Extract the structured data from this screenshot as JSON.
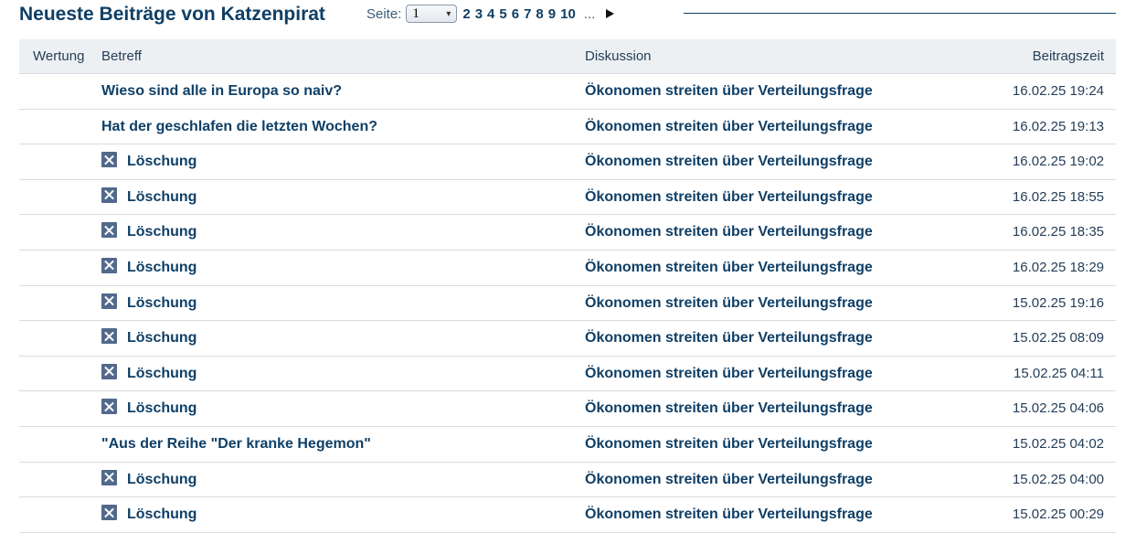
{
  "header": {
    "title": "Neueste Beiträge von Katzenpirat",
    "pager_label": "Seite:",
    "page_select_value": "1",
    "pages": [
      "2",
      "3",
      "4",
      "5",
      "6",
      "7",
      "8",
      "9",
      "10"
    ],
    "ellipsis": "..."
  },
  "table": {
    "columns": {
      "rating": "Wertung",
      "subject": "Betreff",
      "discussion": "Diskussion",
      "time": "Beitragszeit"
    },
    "rows": [
      {
        "deleted": false,
        "subject": "Wieso sind alle in Europa so naiv?",
        "discussion": "Ökonomen streiten über Verteilungsfrage",
        "time": "16.02.25 19:24"
      },
      {
        "deleted": false,
        "subject": "Hat der geschlafen die letzten Wochen?",
        "discussion": "Ökonomen streiten über Verteilungsfrage",
        "time": "16.02.25 19:13"
      },
      {
        "deleted": true,
        "subject": "Löschung",
        "discussion": "Ökonomen streiten über Verteilungsfrage",
        "time": "16.02.25 19:02"
      },
      {
        "deleted": true,
        "subject": "Löschung",
        "discussion": "Ökonomen streiten über Verteilungsfrage",
        "time": "16.02.25 18:55"
      },
      {
        "deleted": true,
        "subject": "Löschung",
        "discussion": "Ökonomen streiten über Verteilungsfrage",
        "time": "16.02.25 18:35"
      },
      {
        "deleted": true,
        "subject": "Löschung",
        "discussion": "Ökonomen streiten über Verteilungsfrage",
        "time": "16.02.25 18:29"
      },
      {
        "deleted": true,
        "subject": "Löschung",
        "discussion": "Ökonomen streiten über Verteilungsfrage",
        "time": "15.02.25 19:16"
      },
      {
        "deleted": true,
        "subject": "Löschung",
        "discussion": "Ökonomen streiten über Verteilungsfrage",
        "time": "15.02.25 08:09"
      },
      {
        "deleted": true,
        "subject": "Löschung",
        "discussion": "Ökonomen streiten über Verteilungsfrage",
        "time": "15.02.25 04:11"
      },
      {
        "deleted": true,
        "subject": "Löschung",
        "discussion": "Ökonomen streiten über Verteilungsfrage",
        "time": "15.02.25 04:06"
      },
      {
        "deleted": false,
        "subject": "\"Aus der Reihe \"Der kranke Hegemon\"",
        "discussion": "Ökonomen streiten über Verteilungsfrage",
        "time": "15.02.25 04:02"
      },
      {
        "deleted": true,
        "subject": "Löschung",
        "discussion": "Ökonomen streiten über Verteilungsfrage",
        "time": "15.02.25 04:00"
      },
      {
        "deleted": true,
        "subject": "Löschung",
        "discussion": "Ökonomen streiten über Verteilungsfrage",
        "time": "15.02.25 00:29"
      }
    ]
  },
  "colors": {
    "brand_text": "#0f3f66",
    "header_background": "#edf0f3",
    "delete_icon": "#52698a"
  }
}
